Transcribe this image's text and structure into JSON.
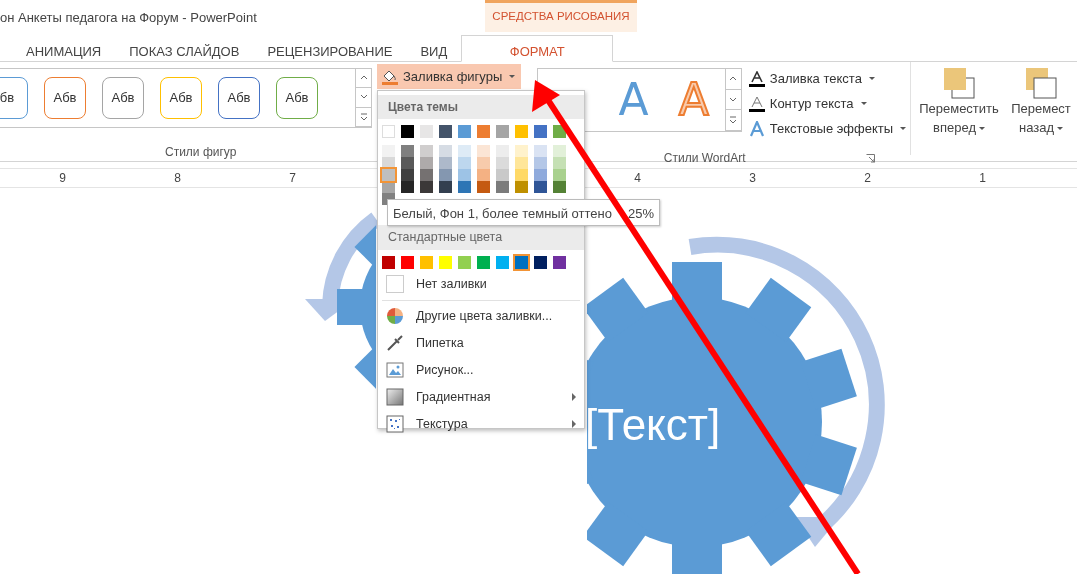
{
  "window": {
    "title": "он Анкеты педагога на Форум - PowerPoint",
    "context_tab_group": "СРЕДСТВА РИСОВАНИЯ"
  },
  "tabs": [
    {
      "label": "АНИМАЦИЯ",
      "selected": false
    },
    {
      "label": "ПОКАЗ СЛАЙДОВ",
      "selected": false
    },
    {
      "label": "РЕЦЕНЗИРОВАНИЕ",
      "selected": false
    },
    {
      "label": "ВИД",
      "selected": false
    },
    {
      "label": "ФОРМАТ",
      "selected": true
    }
  ],
  "ribbon": {
    "shape_styles": {
      "label": "Стили фигур",
      "styles": [
        {
          "text": "бв",
          "color": "#5b9bd5"
        },
        {
          "text": "Абв",
          "color": "#ed7d31"
        },
        {
          "text": "Абв",
          "color": "#a5a5a5"
        },
        {
          "text": "Абв",
          "color": "#ffc000"
        },
        {
          "text": "Абв",
          "color": "#4472c4"
        },
        {
          "text": "Абв",
          "color": "#70ad47"
        }
      ],
      "fill_button": {
        "label": "Заливка фигуры",
        "expanded": true
      }
    },
    "wordart": {
      "label": "Стили WordArt",
      "styles": [
        {
          "text": "A",
          "kind": "plain"
        },
        {
          "text": "A",
          "kind": "outline"
        }
      ],
      "commands": [
        {
          "label": "Заливка текста",
          "kind": "fill"
        },
        {
          "label": "Контур текста",
          "kind": "outline"
        },
        {
          "label": "Текстовые эффекты",
          "kind": "effects"
        }
      ]
    },
    "arrange": [
      {
        "line1": "Переместить",
        "line2": "вперед"
      },
      {
        "line1": "Перемест",
        "line2": "назад"
      }
    ]
  },
  "ruler": [
    "9",
    "8",
    "7",
    "4",
    "3",
    "2",
    "1"
  ],
  "fill_menu": {
    "theme_header": "Цвета темы",
    "theme_colors": [
      {
        "color": "#ffffff",
        "shades": [
          {
            "color": "#f2f2f2",
            "selected": false
          },
          {
            "color": "#d9d9d9",
            "selected": false
          },
          {
            "color": "#bfbfbf",
            "selected": true
          },
          {
            "color": "#a6a6a6",
            "selected": false
          },
          {
            "color": "#808080",
            "selected": false
          }
        ]
      },
      {
        "color": "#000000",
        "shades": [
          {
            "color": "#7f7f7f",
            "selected": false
          },
          {
            "color": "#595959",
            "selected": false
          },
          {
            "color": "#404040",
            "selected": false
          },
          {
            "color": "#262626",
            "selected": false
          }
        ]
      },
      {
        "color": "#e7e6e6",
        "shades": [
          {
            "color": "#d0cece",
            "selected": false
          },
          {
            "color": "#aeaaaa",
            "selected": false
          },
          {
            "color": "#757171",
            "selected": false
          },
          {
            "color": "#3b3838",
            "selected": false
          }
        ]
      },
      {
        "color": "#44546a",
        "shades": [
          {
            "color": "#d6dce4",
            "selected": false
          },
          {
            "color": "#adb9ca",
            "selected": false
          },
          {
            "color": "#8497b0",
            "selected": false
          },
          {
            "color": "#333f4f",
            "selected": false
          }
        ]
      },
      {
        "color": "#5b9bd5",
        "shades": [
          {
            "color": "#deebf6",
            "selected": false
          },
          {
            "color": "#bdd7ee",
            "selected": false
          },
          {
            "color": "#9dc3e6",
            "selected": false
          },
          {
            "color": "#2e75b5",
            "selected": false
          }
        ]
      },
      {
        "color": "#ed7d31",
        "shades": [
          {
            "color": "#fbe5d5",
            "selected": false
          },
          {
            "color": "#f7cbac",
            "selected": false
          },
          {
            "color": "#f4b183",
            "selected": false
          },
          {
            "color": "#c55a11",
            "selected": false
          }
        ]
      },
      {
        "color": "#a5a5a5",
        "shades": [
          {
            "color": "#ededed",
            "selected": false
          },
          {
            "color": "#dbdbdb",
            "selected": false
          },
          {
            "color": "#c9c9c9",
            "selected": false
          },
          {
            "color": "#7b7b7b",
            "selected": false
          }
        ]
      },
      {
        "color": "#ffc000",
        "shades": [
          {
            "color": "#fff2cc",
            "selected": false
          },
          {
            "color": "#ffe699",
            "selected": false
          },
          {
            "color": "#ffd966",
            "selected": false
          },
          {
            "color": "#bf9000",
            "selected": false
          }
        ]
      },
      {
        "color": "#4472c4",
        "shades": [
          {
            "color": "#dae3f3",
            "selected": false
          },
          {
            "color": "#b4c7e7",
            "selected": false
          },
          {
            "color": "#8faadc",
            "selected": false
          },
          {
            "color": "#2f5597",
            "selected": false
          }
        ]
      },
      {
        "color": "#70ad47",
        "shades": [
          {
            "color": "#e2f0d9",
            "selected": false
          },
          {
            "color": "#c5e0b4",
            "selected": false
          },
          {
            "color": "#a9d18e",
            "selected": false
          },
          {
            "color": "#548235",
            "selected": false
          }
        ]
      }
    ],
    "standard_header": "Стандартные цвета",
    "standard_colors": [
      {
        "color": "#c00000",
        "selected": false
      },
      {
        "color": "#ff0000",
        "selected": false
      },
      {
        "color": "#ffc000",
        "selected": false
      },
      {
        "color": "#ffff00",
        "selected": false
      },
      {
        "color": "#92d050",
        "selected": false
      },
      {
        "color": "#00b050",
        "selected": false
      },
      {
        "color": "#00b0f0",
        "selected": false
      },
      {
        "color": "#0070c0",
        "selected": true
      },
      {
        "color": "#002060",
        "selected": false
      },
      {
        "color": "#7030a0",
        "selected": false
      }
    ],
    "items": [
      {
        "label": "Нет заливки",
        "kind": "none",
        "submenu": false
      },
      {
        "label": "Другие цвета заливки...",
        "kind": "colors",
        "submenu": false
      },
      {
        "label": "Пипетка",
        "kind": "eyedropper",
        "submenu": false
      },
      {
        "label": "Рисунок...",
        "kind": "picture",
        "submenu": false
      },
      {
        "label": "Градиентная",
        "kind": "gradient",
        "submenu": true
      },
      {
        "label": "Текстура",
        "kind": "texture",
        "submenu": true
      }
    ],
    "tooltip": [
      "Белый, Фон 1, более темный оттено",
      "25%"
    ]
  },
  "slide": {
    "gear_text": "[Текст]"
  }
}
